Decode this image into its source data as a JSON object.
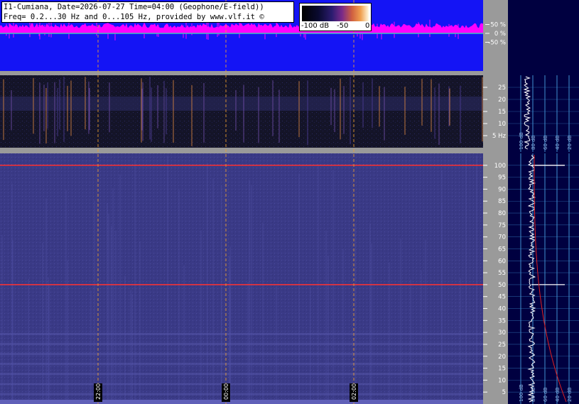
{
  "header": {
    "line1": "I1-Cumiana, Date=2026-07-27 Time=04:00 (Geophone/E-field))",
    "line2": "Freq= 0.2...30 Hz and 0...105 Hz, provided by www.vlf.it ©"
  },
  "colorbar": {
    "min_label": "-100 dB",
    "mid_label": "-50",
    "max_label": "0"
  },
  "colors": {
    "background": "#ffffff",
    "amplitude_bg": "#1414f5",
    "amplitude_trace": "#ff00ff",
    "spectrogram_bg": "#3a3a86",
    "panel_gray": "#9a9a9a",
    "side_panel": "#000040",
    "grid_lines": "#3f8fd0",
    "time_markers": "#f0a030",
    "mains_line": "#ff3030"
  },
  "chart_data": [
    {
      "type": "line",
      "name": "amplitude",
      "ylabel_ticks": [
        "50 %",
        "0 %",
        "-50 %"
      ],
      "ylim": [
        -100,
        100
      ],
      "y_ticks": [
        50,
        0,
        -50
      ]
    },
    {
      "type": "heatmap",
      "name": "spectrogram-low",
      "ylim": [
        0,
        30
      ],
      "y_ticks": [
        5,
        10,
        15,
        20,
        25
      ],
      "y_tick_labels": [
        "5 Hz",
        "10",
        "15",
        "20",
        "25"
      ]
    },
    {
      "type": "heatmap",
      "name": "spectrogram-high",
      "ylim": [
        0,
        105
      ],
      "y_ticks": [
        5,
        10,
        15,
        20,
        25,
        30,
        35,
        40,
        45,
        50,
        55,
        60,
        65,
        70,
        75,
        80,
        85,
        90,
        95,
        100
      ],
      "time_markers": [
        "22:00",
        "00:00",
        "02:00"
      ],
      "mains_lines_hz": [
        50,
        100
      ]
    },
    {
      "type": "line",
      "name": "spectrum-low",
      "x_tick_labels": [
        "100 dB",
        "80 dB",
        "60 dB",
        "40 dB",
        "20 dB"
      ]
    },
    {
      "type": "line",
      "name": "spectrum-high",
      "x_tick_labels": [
        "100 dB",
        "80 dB",
        "60 dB",
        "40 dB",
        "20 dB"
      ]
    }
  ]
}
